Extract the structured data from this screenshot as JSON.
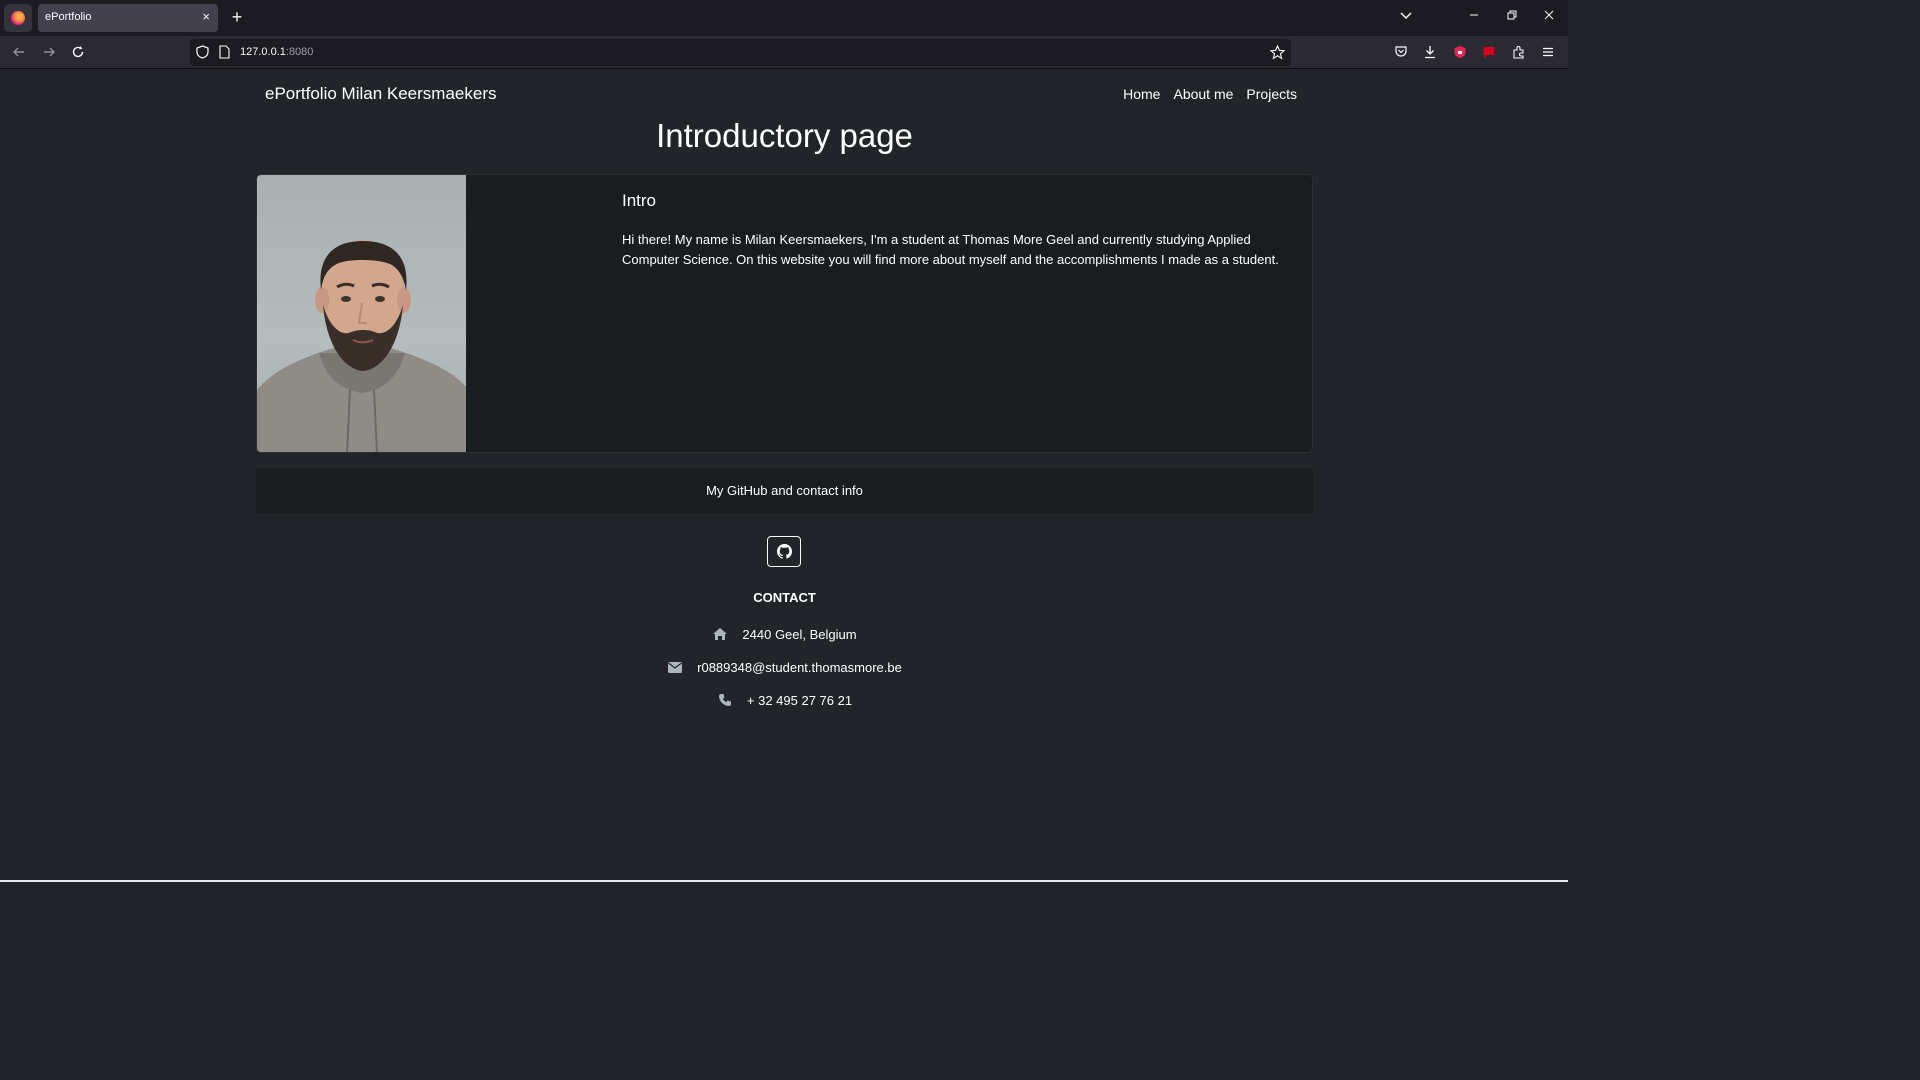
{
  "browser": {
    "tab_title": "ePortfolio",
    "tab_close": "×",
    "new_tab": "+",
    "url_host": "127.0.0.1",
    "url_port": ":8080",
    "window_controls": [
      "minimize-icon",
      "restore-icon",
      "close-icon"
    ],
    "toolbar_icons": [
      "pocket-icon",
      "download-icon",
      "extension-red-icon",
      "extension-flag-icon",
      "extensions-icon",
      "menu-icon"
    ]
  },
  "site": {
    "brand": "ePortfolio Milan Keersmaekers",
    "nav": [
      "Home",
      "About me",
      "Projects"
    ],
    "page_title": "Introductory page"
  },
  "card": {
    "title": "Intro",
    "text": "Hi there! My name is Milan Keersmaekers, I'm a student at Thomas More Geel and currently studying Applied Computer Science. On this website you will find more about myself and the accomplishments I made as a student."
  },
  "footer": {
    "heading": "My GitHub and contact info",
    "contact_title": "CONTACT",
    "address": "2440 Geel, Belgium",
    "email": "r0889348@student.thomasmore.be",
    "phone": "+ 32 495 27 76 21"
  },
  "colors": {
    "page_bg": "#212529",
    "card_bg": "#1a1d20",
    "text": "#ffffff",
    "icon_gray": "#adb5bd"
  }
}
